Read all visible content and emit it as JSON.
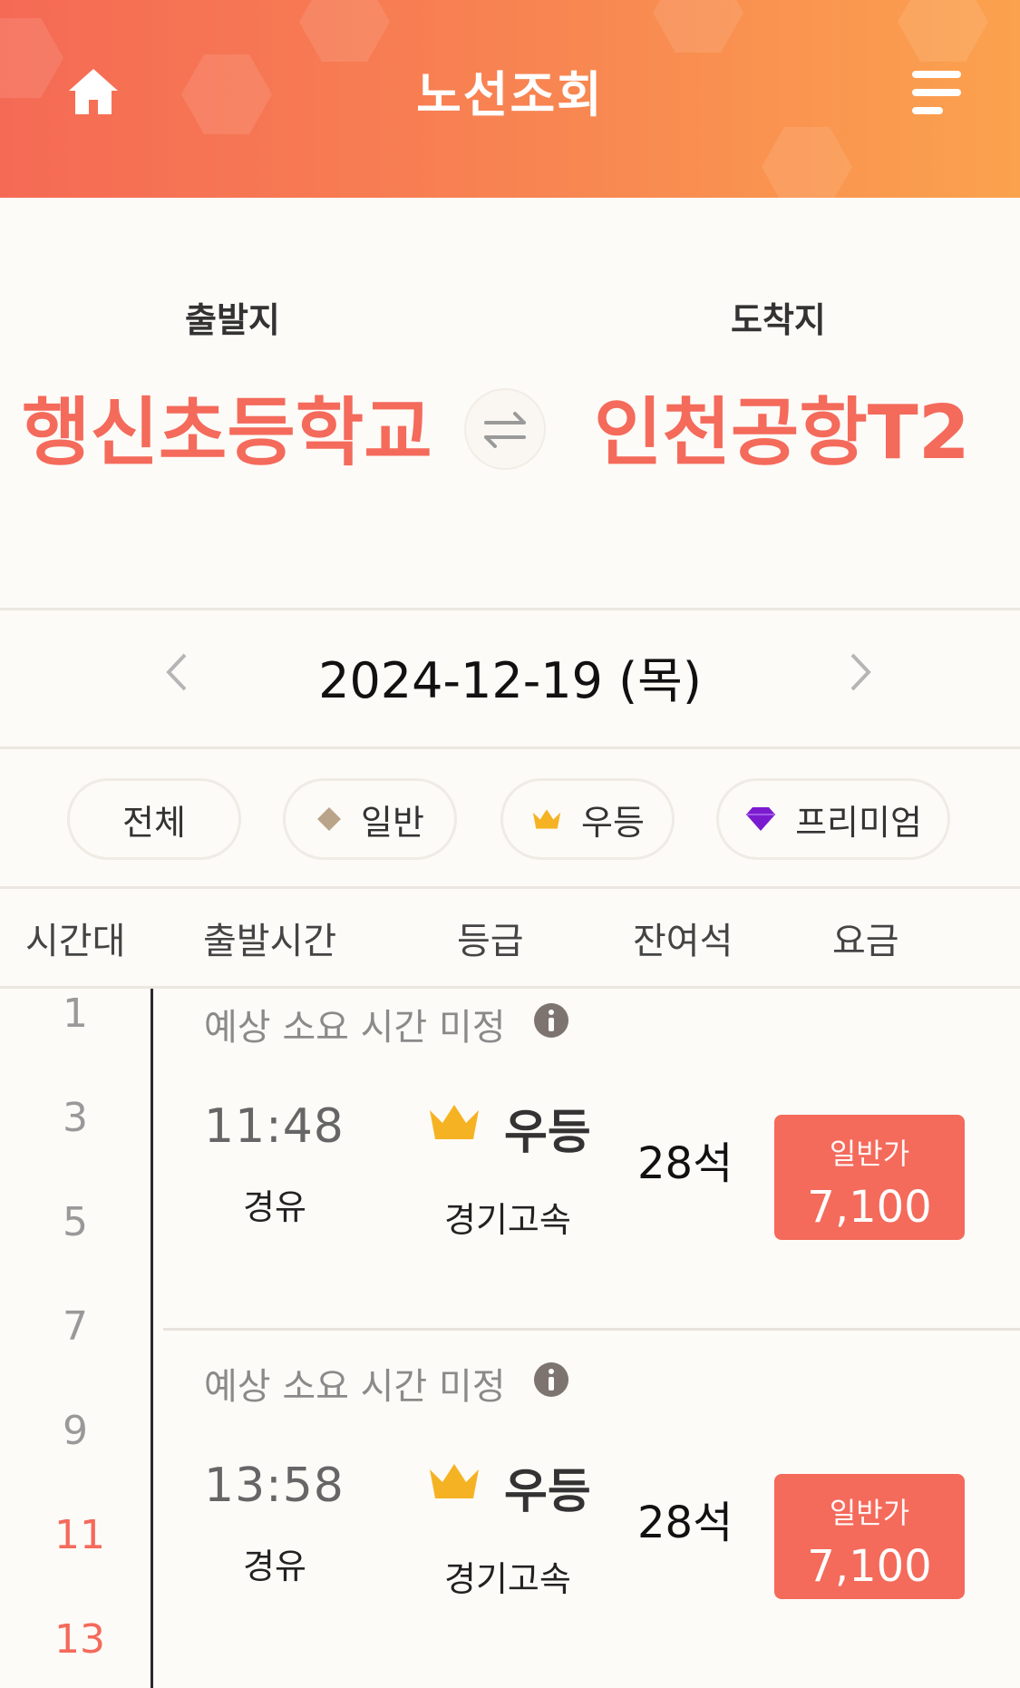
{
  "header": {
    "title": "노선조회"
  },
  "route": {
    "origin_label": "출발지",
    "origin": "행신초등학교",
    "destination_label": "도착지",
    "destination": "인천공항T2"
  },
  "date": {
    "text": "2024-12-19 (목)"
  },
  "filters": [
    {
      "label": "전체"
    },
    {
      "label": "일반"
    },
    {
      "label": "우등"
    },
    {
      "label": "프리미엄"
    }
  ],
  "columns": [
    "시간대",
    "출발시간",
    "등급",
    "잔여석",
    "요금"
  ],
  "time_axis": [
    {
      "label": "1",
      "active": false
    },
    {
      "label": "3",
      "active": false
    },
    {
      "label": "5",
      "active": false
    },
    {
      "label": "7",
      "active": false
    },
    {
      "label": "9",
      "active": false
    },
    {
      "label": "11",
      "active": true
    },
    {
      "label": "13",
      "active": true
    }
  ],
  "routes": [
    {
      "estimate": "예상 소요 시간 미정",
      "time": "11:48",
      "via": "경유",
      "grade": "우등",
      "company": "경기고속",
      "seats": "28석",
      "price_label": "일반가",
      "price": "7,100"
    },
    {
      "estimate": "예상 소요 시간 미정",
      "time": "13:58",
      "via": "경유",
      "grade": "우등",
      "company": "경기고속",
      "seats": "28석",
      "price_label": "일반가",
      "price": "7,100"
    }
  ],
  "colors": {
    "accent": "#f46a5b",
    "header_start": "#f56a55",
    "header_end": "#fba24e"
  },
  "icons": [
    "home-icon",
    "menu-icon",
    "swap-icon",
    "chevron-left-icon",
    "chevron-right-icon",
    "diamond-icon",
    "crown-icon",
    "gem-icon",
    "info-icon"
  ]
}
